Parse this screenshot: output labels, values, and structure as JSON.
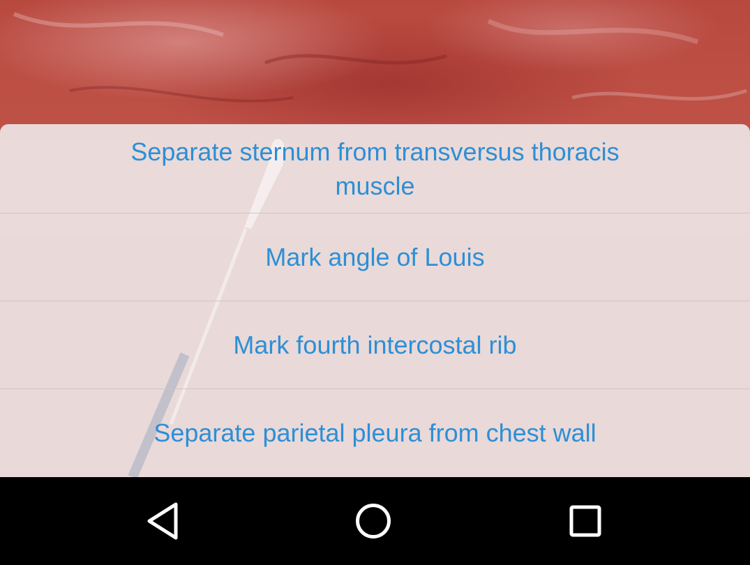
{
  "options": [
    {
      "label": "Separate sternum from transversus thoracis muscle"
    },
    {
      "label": "Mark angle of Louis"
    },
    {
      "label": "Mark fourth intercostal rib"
    },
    {
      "label": "Separate parietal pleura from chest wall"
    }
  ],
  "navbar": {
    "back_icon": "back-triangle-icon",
    "home_icon": "home-circle-icon",
    "recents_icon": "recents-square-icon"
  },
  "colors": {
    "option_text": "#2d8fd6",
    "sheet_background": "#ece2e2",
    "navbar_background": "#000000",
    "background_tissue": "#b8493f"
  }
}
